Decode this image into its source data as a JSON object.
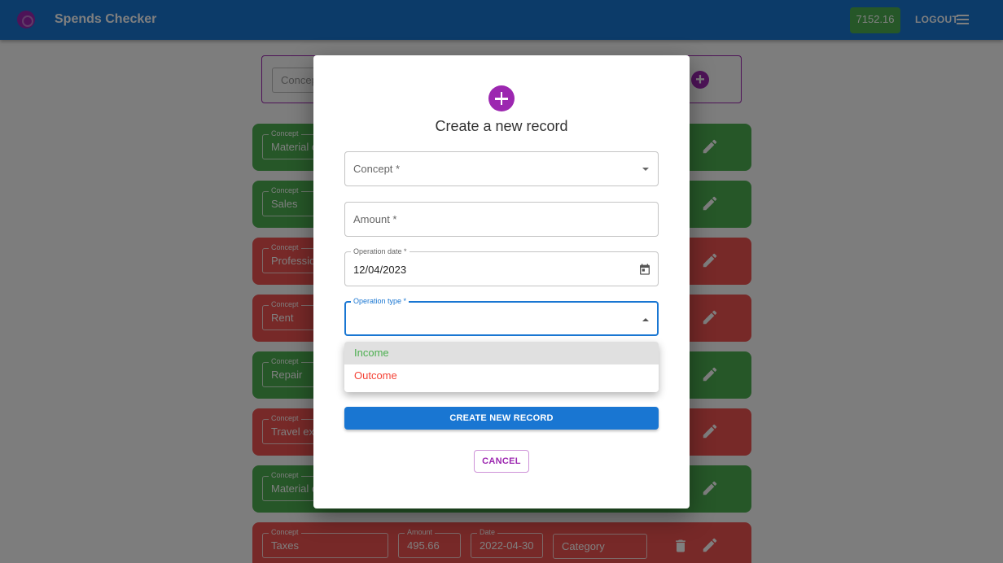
{
  "app": {
    "title": "Spends Checker",
    "balance": "7152.16",
    "logout_label": "LOGOUT"
  },
  "filter": {
    "concept_placeholder": "Concept"
  },
  "records": [
    {
      "type": "income",
      "concept_label": "Concept",
      "concept": "Material c"
    },
    {
      "type": "income",
      "concept_label": "Concept",
      "concept": "Sales"
    },
    {
      "type": "outcome",
      "concept_label": "Concept",
      "concept": "Professio"
    },
    {
      "type": "outcome",
      "concept_label": "Concept",
      "concept": "Rent"
    },
    {
      "type": "income",
      "concept_label": "Concept",
      "concept": "Repair"
    },
    {
      "type": "outcome",
      "concept_label": "Concept",
      "concept": "Travel exp"
    },
    {
      "type": "income",
      "concept_label": "Concept",
      "concept": "Material c"
    },
    {
      "type": "outcome",
      "concept_label": "Concept",
      "concept": "Taxes",
      "amount_label": "Amount",
      "amount": "495.66",
      "date_label": "Date",
      "date": "2022-04-30",
      "category_placeholder": "Category"
    }
  ],
  "dialog": {
    "title": "Create a new record",
    "concept_placeholder": "Concept *",
    "amount_placeholder": "Amount *",
    "date_label": "Operation date *",
    "date_value": "12/04/2023",
    "type_label": "Operation type *",
    "create_label": "CREATE NEW RECORD",
    "cancel_label": "CANCEL"
  },
  "type_menu": {
    "options": [
      "Income",
      "Outcome"
    ],
    "highlighted": "Income"
  },
  "colors": {
    "primary": "#1976d2",
    "secondary": "#9c27b0",
    "income": "#4caf50",
    "outcome": "#ef5350"
  }
}
